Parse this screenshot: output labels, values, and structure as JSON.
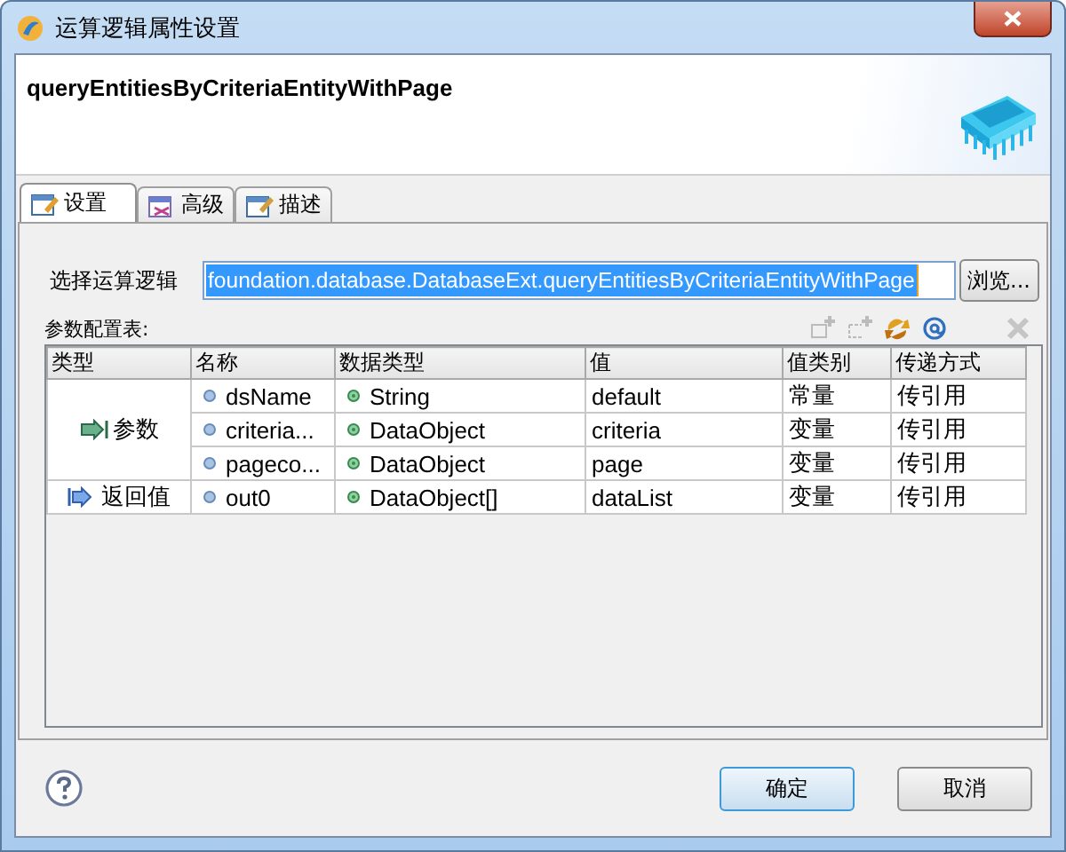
{
  "window": {
    "title": "运算逻辑属性设置"
  },
  "header": {
    "title": "queryEntitiesByCriteriaEntityWithPage"
  },
  "tabs": [
    {
      "label": "设置",
      "selected": true
    },
    {
      "label": "高级",
      "selected": false
    },
    {
      "label": "描述",
      "selected": false
    }
  ],
  "logic_field": {
    "label": "选择运算逻辑",
    "value": "foundation.database.DatabaseExt.queryEntitiesByCriteriaEntityWithPage",
    "text_selected": true,
    "browse_button": "浏览..."
  },
  "param_table": {
    "label": "参数配置表:",
    "toolbar": [
      {
        "kind": "add",
        "disabled": true
      },
      {
        "kind": "insert",
        "disabled": true
      },
      {
        "kind": "refresh",
        "disabled": false
      },
      {
        "kind": "at",
        "disabled": false
      },
      {
        "kind": "delete",
        "disabled": true
      }
    ],
    "columns": [
      "类型",
      "名称",
      "数据类型",
      "值",
      "值类别",
      "传递方式"
    ],
    "groups": [
      {
        "type": "参数",
        "kind": "param",
        "rows": [
          {
            "name": "dsName",
            "data_type": "String",
            "value": "default",
            "value_kind": "常量",
            "passing": "传引用"
          },
          {
            "name": "criteria...",
            "data_type": "DataObject",
            "value": "criteria",
            "value_kind": "变量",
            "passing": "传引用"
          },
          {
            "name": "pageco...",
            "data_type": "DataObject",
            "value": "page",
            "value_kind": "变量",
            "passing": "传引用"
          }
        ]
      },
      {
        "type": "返回值",
        "kind": "return",
        "rows": [
          {
            "name": "out0",
            "data_type": "DataObject[]",
            "value": "dataList",
            "value_kind": "变量",
            "passing": "传引用"
          }
        ]
      }
    ]
  },
  "buttons": [
    {
      "label": "确定",
      "default": true
    },
    {
      "label": "取消",
      "default": false
    }
  ]
}
